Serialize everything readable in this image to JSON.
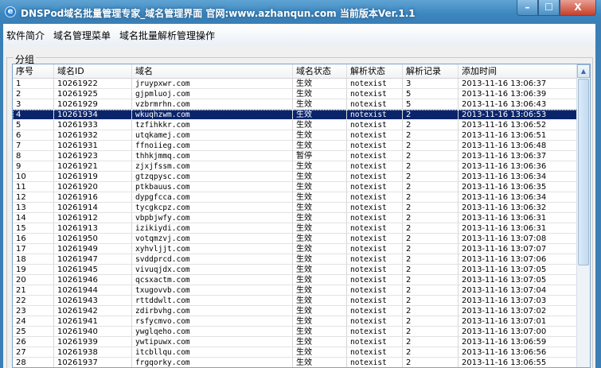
{
  "window": {
    "title": "DNSPod域名批量管理专家_域名管理界面  官网:www.azhanqun.com   当前版本Ver.1.1",
    "icon": "ie-icon",
    "minimize": "–",
    "maximize": "☐",
    "close": "X"
  },
  "menu": [
    "软件简介",
    "域名管理菜单",
    "域名批量解析管理操作"
  ],
  "group_label": "分组",
  "columns": [
    "序号",
    "域名ID",
    "域名",
    "域名状态",
    "解析状态",
    "解析记录",
    "添加时间"
  ],
  "selected_index": 3,
  "rows": [
    [
      "1",
      "10261922",
      "jruypxwr.com",
      "生效",
      "notexist",
      "3",
      "2013-11-16 13:06:37"
    ],
    [
      "2",
      "10261925",
      "gjpmluoj.com",
      "生效",
      "notexist",
      "5",
      "2013-11-16 13:06:39"
    ],
    [
      "3",
      "10261929",
      "vzbrmrhn.com",
      "生效",
      "notexist",
      "5",
      "2013-11-16 13:06:43"
    ],
    [
      "4",
      "10261934",
      "wkuqhzwm.com",
      "生效",
      "notexist",
      "2",
      "2013-11-16 13:06:53"
    ],
    [
      "5",
      "10261933",
      "tzfihkkr.com",
      "生效",
      "notexist",
      "2",
      "2013-11-16 13:06:52"
    ],
    [
      "6",
      "10261932",
      "utqkamej.com",
      "生效",
      "notexist",
      "2",
      "2013-11-16 13:06:51"
    ],
    [
      "7",
      "10261931",
      "ffnoiieg.com",
      "生效",
      "notexist",
      "2",
      "2013-11-16 13:06:48"
    ],
    [
      "8",
      "10261923",
      "thhkjmmq.com",
      "暂停",
      "notexist",
      "2",
      "2013-11-16 13:06:37"
    ],
    [
      "9",
      "10261921",
      "zjxjfssm.com",
      "生效",
      "notexist",
      "2",
      "2013-11-16 13:06:36"
    ],
    [
      "10",
      "10261919",
      "gtzqpysc.com",
      "生效",
      "notexist",
      "2",
      "2013-11-16 13:06:34"
    ],
    [
      "11",
      "10261920",
      "ptkbauus.com",
      "生效",
      "notexist",
      "2",
      "2013-11-16 13:06:35"
    ],
    [
      "12",
      "10261916",
      "dypgfcca.com",
      "生效",
      "notexist",
      "2",
      "2013-11-16 13:06:34"
    ],
    [
      "13",
      "10261914",
      "tycgkcpz.com",
      "生效",
      "notexist",
      "2",
      "2013-11-16 13:06:32"
    ],
    [
      "14",
      "10261912",
      "vbpbjwfy.com",
      "生效",
      "notexist",
      "2",
      "2013-11-16 13:06:31"
    ],
    [
      "15",
      "10261913",
      "izikiydi.com",
      "生效",
      "notexist",
      "2",
      "2013-11-16 13:06:31"
    ],
    [
      "16",
      "10261950",
      "votqmzvj.com",
      "生效",
      "notexist",
      "2",
      "2013-11-16 13:07:08"
    ],
    [
      "17",
      "10261949",
      "xyhvljjt.com",
      "生效",
      "notexist",
      "2",
      "2013-11-16 13:07:07"
    ],
    [
      "18",
      "10261947",
      "svddprcd.com",
      "生效",
      "notexist",
      "2",
      "2013-11-16 13:07:06"
    ],
    [
      "19",
      "10261945",
      "vivuqjdx.com",
      "生效",
      "notexist",
      "2",
      "2013-11-16 13:07:05"
    ],
    [
      "20",
      "10261946",
      "qcsxactm.com",
      "生效",
      "notexist",
      "2",
      "2013-11-16 13:07:05"
    ],
    [
      "21",
      "10261944",
      "txugovvb.com",
      "生效",
      "notexist",
      "2",
      "2013-11-16 13:07:04"
    ],
    [
      "22",
      "10261943",
      "rttddwlt.com",
      "生效",
      "notexist",
      "2",
      "2013-11-16 13:07:03"
    ],
    [
      "23",
      "10261942",
      "zdirbvhg.com",
      "生效",
      "notexist",
      "2",
      "2013-11-16 13:07:02"
    ],
    [
      "24",
      "10261941",
      "rsfycmvo.com",
      "生效",
      "notexist",
      "2",
      "2013-11-16 13:07:01"
    ],
    [
      "25",
      "10261940",
      "ywglqeho.com",
      "生效",
      "notexist",
      "2",
      "2013-11-16 13:07:00"
    ],
    [
      "26",
      "10261939",
      "ywtipuwx.com",
      "生效",
      "notexist",
      "2",
      "2013-11-16 13:06:59"
    ],
    [
      "27",
      "10261938",
      "itcbllqu.com",
      "生效",
      "notexist",
      "2",
      "2013-11-16 13:06:56"
    ],
    [
      "28",
      "10261937",
      "frgqorky.com",
      "生效",
      "notexist",
      "2",
      "2013-11-16 13:06:55"
    ]
  ]
}
